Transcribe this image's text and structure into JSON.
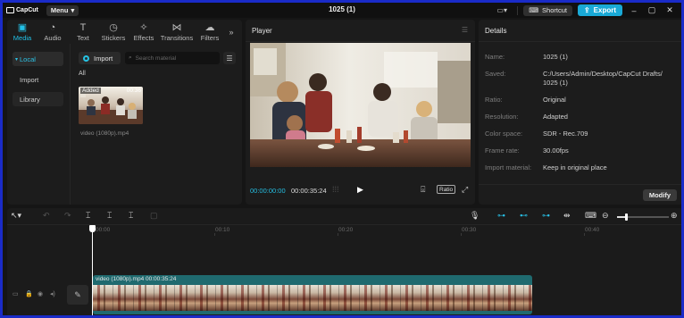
{
  "app": {
    "name": "CapCut",
    "menu_label": "Menu",
    "project_title": "1025 (1)"
  },
  "titlebar": {
    "shortcut_label": "Shortcut",
    "export_label": "Export"
  },
  "media_tabs": [
    {
      "label": "Media",
      "icon": "media-icon",
      "active": true
    },
    {
      "label": "Audio",
      "icon": "audio-icon",
      "active": false
    },
    {
      "label": "Text",
      "icon": "text-icon",
      "active": false
    },
    {
      "label": "Stickers",
      "icon": "stickers-icon",
      "active": false
    },
    {
      "label": "Effects",
      "icon": "effects-icon",
      "active": false
    },
    {
      "label": "Transitions",
      "icon": "transitions-icon",
      "active": false
    },
    {
      "label": "Filters",
      "icon": "filters-icon",
      "active": false
    }
  ],
  "side_nav": {
    "local": "Local",
    "import": "Import",
    "library": "Library"
  },
  "media": {
    "import_label": "Import",
    "search_placeholder": "Search material",
    "filter_all": "All",
    "items": [
      {
        "badge": "Added",
        "duration": "00:36",
        "name": "video (1080p).mp4"
      }
    ]
  },
  "player": {
    "title": "Player",
    "current_time": "00:00:00:00",
    "total_time": "00:00:35:24",
    "ratio_label": "Ratio"
  },
  "details": {
    "title": "Details",
    "rows": [
      {
        "label": "Name:",
        "value": "1025 (1)"
      },
      {
        "label": "Saved:",
        "value": "C:/Users/Admin/Desktop/CapCut Drafts/ 1025 (1)"
      },
      {
        "label": "Ratio:",
        "value": "Original"
      },
      {
        "label": "Resolution:",
        "value": "Adapted"
      },
      {
        "label": "Color space:",
        "value": "SDR - Rec.709"
      },
      {
        "label": "Frame rate:",
        "value": "30.00fps"
      },
      {
        "label": "Import material:",
        "value": "Keep in original place"
      }
    ],
    "modify_label": "Modify"
  },
  "timeline": {
    "ruler_labels": [
      "00:00",
      "00:10",
      "00:20",
      "00:30",
      "00:40"
    ],
    "clip_label": "video (1080p).mp4  00:00:35:24",
    "zoom_level": 0.18
  },
  "colors": {
    "accent": "#22c0e6",
    "export": "#19a9d6",
    "clip": "#1f6a6f"
  }
}
